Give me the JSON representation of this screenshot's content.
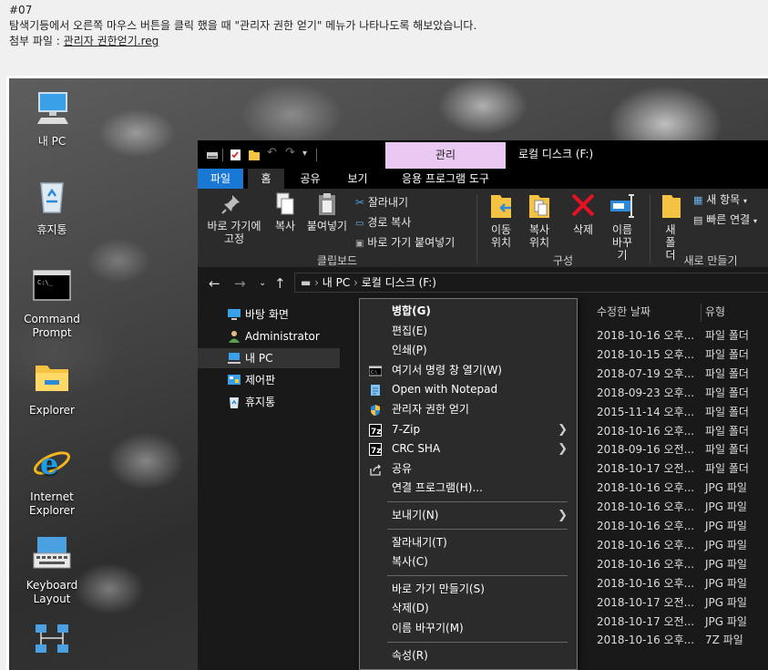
{
  "post": {
    "number": "#07",
    "description": "탐색기등에서 오른쪽 마우스 버튼을 클릭 했을 때 \"관리자 권한 얻기\" 메뉴가 나타나도록 해보았습니다.",
    "attach_label": "첨부 파일 : ",
    "attach_file": "관리자 권한얻기.reg"
  },
  "desktop": {
    "icons": [
      {
        "label": "내 PC",
        "icon": "computer-icon"
      },
      {
        "label": "휴지통",
        "icon": "recycle-bin-icon"
      },
      {
        "label": "Command Prompt",
        "icon": "command-prompt-icon"
      },
      {
        "label": "Explorer",
        "icon": "folder-icon"
      },
      {
        "label": "Internet Explorer",
        "icon": "internet-explorer-icon"
      },
      {
        "label": "Keyboard Layout",
        "icon": "keyboard-icon"
      }
    ]
  },
  "explorer": {
    "context_tab": "관리",
    "window_title": "로컬 디스크 (F:)",
    "tabs": [
      "파일",
      "홈",
      "공유",
      "보기",
      "응용 프로그램 도구"
    ],
    "ribbon": {
      "pin_quick_access": "바로 가기에 고정",
      "copy": "복사",
      "paste": "붙여넣기",
      "cut": "잘라내기",
      "copy_path": "경로 복사",
      "paste_shortcut": "바로 가기 붙여넣기",
      "clipboard_group": "클립보드",
      "move_to": "이동 위치",
      "copy_to": "복사 위치",
      "delete": "삭제",
      "rename": "이름 바꾸기",
      "organize_group": "구성",
      "new_folder": "새 폴더",
      "new_item": "새 항목",
      "easy_access": "빠른 연결",
      "new_group": "새로 만들기"
    },
    "address": {
      "pc": "내 PC",
      "drive": "로컬 디스크 (F:)"
    },
    "nav_items": [
      {
        "label": "바탕 화면",
        "icon": "desktop-icon"
      },
      {
        "label": "Administrator",
        "icon": "user-icon"
      },
      {
        "label": "내 PC",
        "icon": "computer-icon"
      },
      {
        "label": "제어판",
        "icon": "control-panel-icon"
      },
      {
        "label": "휴지통",
        "icon": "recycle-bin-icon"
      }
    ],
    "columns": {
      "date": "수정한 날짜",
      "type": "유형"
    },
    "rows": [
      {
        "date": "2018-10-16 오후...",
        "type": "파일 폴더"
      },
      {
        "date": "2018-10-15 오후...",
        "type": "파일 폴더"
      },
      {
        "date": "2018-07-19 오후...",
        "type": "파일 폴더"
      },
      {
        "date": "2018-09-23 오후...",
        "type": "파일 폴더"
      },
      {
        "date": "2015-11-14 오후...",
        "type": "파일 폴더"
      },
      {
        "date": "2018-10-16 오후...",
        "type": "파일 폴더"
      },
      {
        "date": "2018-09-16 오전...",
        "type": "파일 폴더"
      },
      {
        "date": "2018-10-17 오전...",
        "type": "파일 폴더"
      },
      {
        "date": "2018-10-16 오후...",
        "type": "JPG 파일"
      },
      {
        "date": "2018-10-16 오후...",
        "type": "JPG 파일"
      },
      {
        "date": "2018-10-16 오후...",
        "type": "JPG 파일"
      },
      {
        "date": "2018-10-16 오후...",
        "type": "JPG 파일"
      },
      {
        "date": "2018-10-16 오후...",
        "type": "JPG 파일"
      },
      {
        "date": "2018-10-16 오후...",
        "type": "JPG 파일"
      },
      {
        "date": "2018-10-17 오전...",
        "type": "JPG 파일"
      },
      {
        "date": "2018-10-17 오전...",
        "type": "JPG 파일"
      },
      {
        "date": "2018-10-16 오후...",
        "type": "7Z 파일"
      }
    ]
  },
  "context_menu": {
    "items": [
      {
        "label": "병합(G)",
        "bold": true
      },
      {
        "label": "편집(E)"
      },
      {
        "label": "인쇄(P)"
      },
      {
        "label": "여기서 명령 창 열기(W)",
        "icon": "command-prompt-icon"
      },
      {
        "label": "Open with Notepad",
        "icon": "notepad-icon"
      },
      {
        "label": "관리자 권한 얻기",
        "icon": "shield-icon"
      },
      {
        "label": "7-Zip",
        "icon": "7zip-icon",
        "submenu": true
      },
      {
        "label": "CRC SHA",
        "icon": "7zip-icon",
        "submenu": true
      },
      {
        "label": "공유",
        "icon": "share-icon"
      },
      {
        "label": "연결 프로그램(H)..."
      },
      {
        "label": "보내기(N)",
        "submenu": true
      },
      {
        "label": "잘라내기(T)"
      },
      {
        "label": "복사(C)"
      },
      {
        "label": "바로 가기 만들기(S)"
      },
      {
        "label": "삭제(D)"
      },
      {
        "label": "이름 바꾸기(M)"
      },
      {
        "label": "속성(R)"
      }
    ]
  }
}
